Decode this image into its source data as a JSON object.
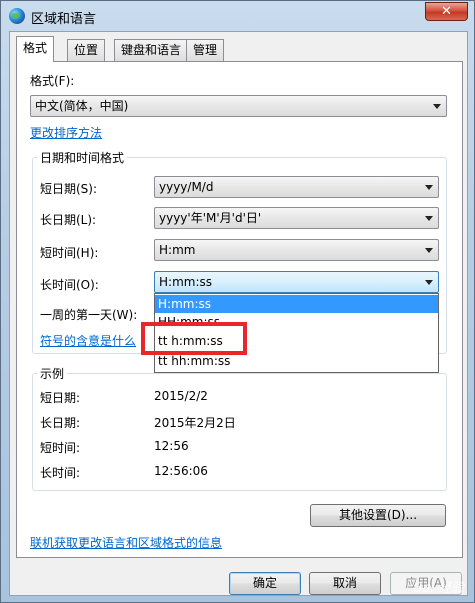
{
  "window": {
    "title": "区域和语言",
    "close_glyph": "✕"
  },
  "tabs": [
    {
      "label": "格式"
    },
    {
      "label": "位置"
    },
    {
      "label": "键盘和语言"
    },
    {
      "label": "管理"
    }
  ],
  "format": {
    "label": "格式(F):",
    "selected": "中文(简体，中国)",
    "sort_link": "更改排序方法"
  },
  "datetime_group": {
    "title": "日期和时间格式",
    "short_date": {
      "label": "短日期(S):",
      "value": "yyyy/M/d"
    },
    "long_date": {
      "label": "长日期(L):",
      "value": "yyyy'年'M'月'd'日'"
    },
    "short_time": {
      "label": "短时间(H):",
      "value": "H:mm"
    },
    "long_time": {
      "label": "长时间(O):",
      "value": "H:mm:ss"
    },
    "first_day": {
      "label": "一周的第一天(W):"
    },
    "symbols_link": "符号的含意是什么"
  },
  "long_time_dropdown": {
    "options": [
      "H:mm:ss",
      "HH:mm:ss",
      "tt h:mm:ss",
      "tt hh:mm:ss"
    ],
    "selected_index": 0,
    "highlighted_option": "tt h:mm:ss"
  },
  "examples": {
    "title": "示例",
    "rows": [
      {
        "label": "短日期:",
        "value": "2015/2/2"
      },
      {
        "label": "长日期:",
        "value": "2015年2月2日"
      },
      {
        "label": "短时间:",
        "value": "12:56"
      },
      {
        "label": "长时间:",
        "value": "12:56:06"
      }
    ]
  },
  "other_settings_button": "其他设置(D)...",
  "online_link": "联机获取更改语言和区域格式的信息",
  "buttons": {
    "ok": "确定",
    "cancel": "取消",
    "apply": "应用(A)"
  },
  "watermark": "Bai 经验",
  "colors": {
    "highlight_border": "#e8262b",
    "selection": "#3399ff",
    "link": "#0066cc"
  }
}
